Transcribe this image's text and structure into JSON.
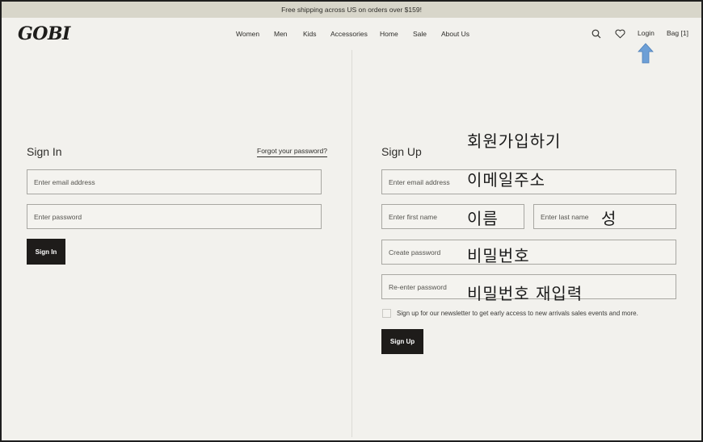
{
  "promo": {
    "text": "Free shipping across US on orders over $159!"
  },
  "header": {
    "logo": "GOBI",
    "nav": [
      "Women",
      "Men",
      "Kids",
      "Accessories",
      "Home",
      "Sale",
      "About Us"
    ],
    "login": "Login",
    "bag": "Bag [1]"
  },
  "signin": {
    "title": "Sign In",
    "forgot": "Forgot your password?",
    "email_placeholder": "Enter email address",
    "password_placeholder": "Enter password",
    "button": "Sign In"
  },
  "signup": {
    "title": "Sign Up",
    "email_placeholder": "Enter email address",
    "first_name_placeholder": "Enter first name",
    "last_name_placeholder": "Enter last name",
    "create_password_placeholder": "Create password",
    "reenter_password_placeholder": "Re-enter password",
    "newsletter": "Sign up for our newsletter to get early access to new arrivals sales events and more.",
    "button": "Sign Up"
  },
  "annotations": {
    "signup_heading": "회원가입하기",
    "email": "이메일주소",
    "first_name": "이름",
    "last_name": "성",
    "password": "비밀번호",
    "reenter_password": "비밀번호 재입력"
  },
  "colors": {
    "background": "#f2f1ed",
    "promo_bar": "#d8d6ca",
    "button": "#1e1c1a",
    "arrow": "#6d9fd6"
  },
  "icons": [
    "search-icon",
    "heart-icon",
    "arrow-up-icon"
  ]
}
